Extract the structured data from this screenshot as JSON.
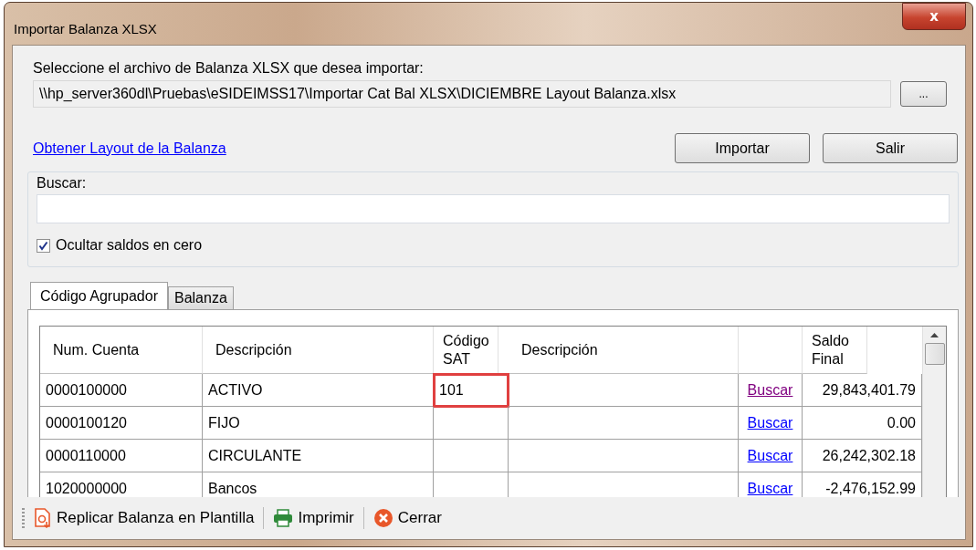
{
  "window": {
    "title": "Importar Balanza XLSX",
    "close": "x"
  },
  "file": {
    "label": "Seleccione el archivo de Balanza XLSX que desea importar:",
    "value": "\\\\hp_server360dl\\Pruebas\\eSIDEIMSS17\\Importar Cat Bal XLSX\\DICIEMBRE Layout Balanza.xlsx",
    "browse": "..."
  },
  "layout_link": "Obtener Layout de la Balanza",
  "buttons": [
    "Importar",
    "Salir"
  ],
  "search": {
    "label": "Buscar:"
  },
  "hide_zero": {
    "label": "Ocultar saldos en cero",
    "checked": true
  },
  "tabs": [
    {
      "label": "Código Agrupador",
      "selected": true
    },
    {
      "label": "Balanza",
      "selected": false
    }
  ],
  "table": {
    "columns": [
      "Num. Cuenta",
      "Descripción",
      "Código SAT",
      "Descripción",
      null,
      "Saldo Final"
    ],
    "rows": [
      {
        "cuenta": "0000100000",
        "descripcion": "ACTIVO",
        "codigo_sat": "101",
        "editing": true,
        "link": "Buscar",
        "visited": true,
        "saldo": "29,843,401.79"
      },
      {
        "cuenta": "0000100120",
        "descripcion": "FIJO",
        "editing": false,
        "link": "Buscar",
        "visited": false,
        "saldo": "0.00"
      },
      {
        "cuenta": "0000110000",
        "descripcion": "CIRCULANTE",
        "editing": false,
        "link": "Buscar",
        "visited": false,
        "saldo": "26,242,302.18"
      },
      {
        "cuenta": "1020000000",
        "descripcion": "Bancos",
        "editing": false,
        "link": "Buscar",
        "visited": false,
        "saldo": "-2,476,152.99"
      }
    ]
  },
  "toolbar": [
    {
      "kind": "replicate",
      "label": "Replicar Balanza en Plantilla"
    },
    {
      "kind": "print",
      "label": "Imprimir"
    },
    {
      "kind": "close",
      "label": "Cerrar"
    }
  ]
}
